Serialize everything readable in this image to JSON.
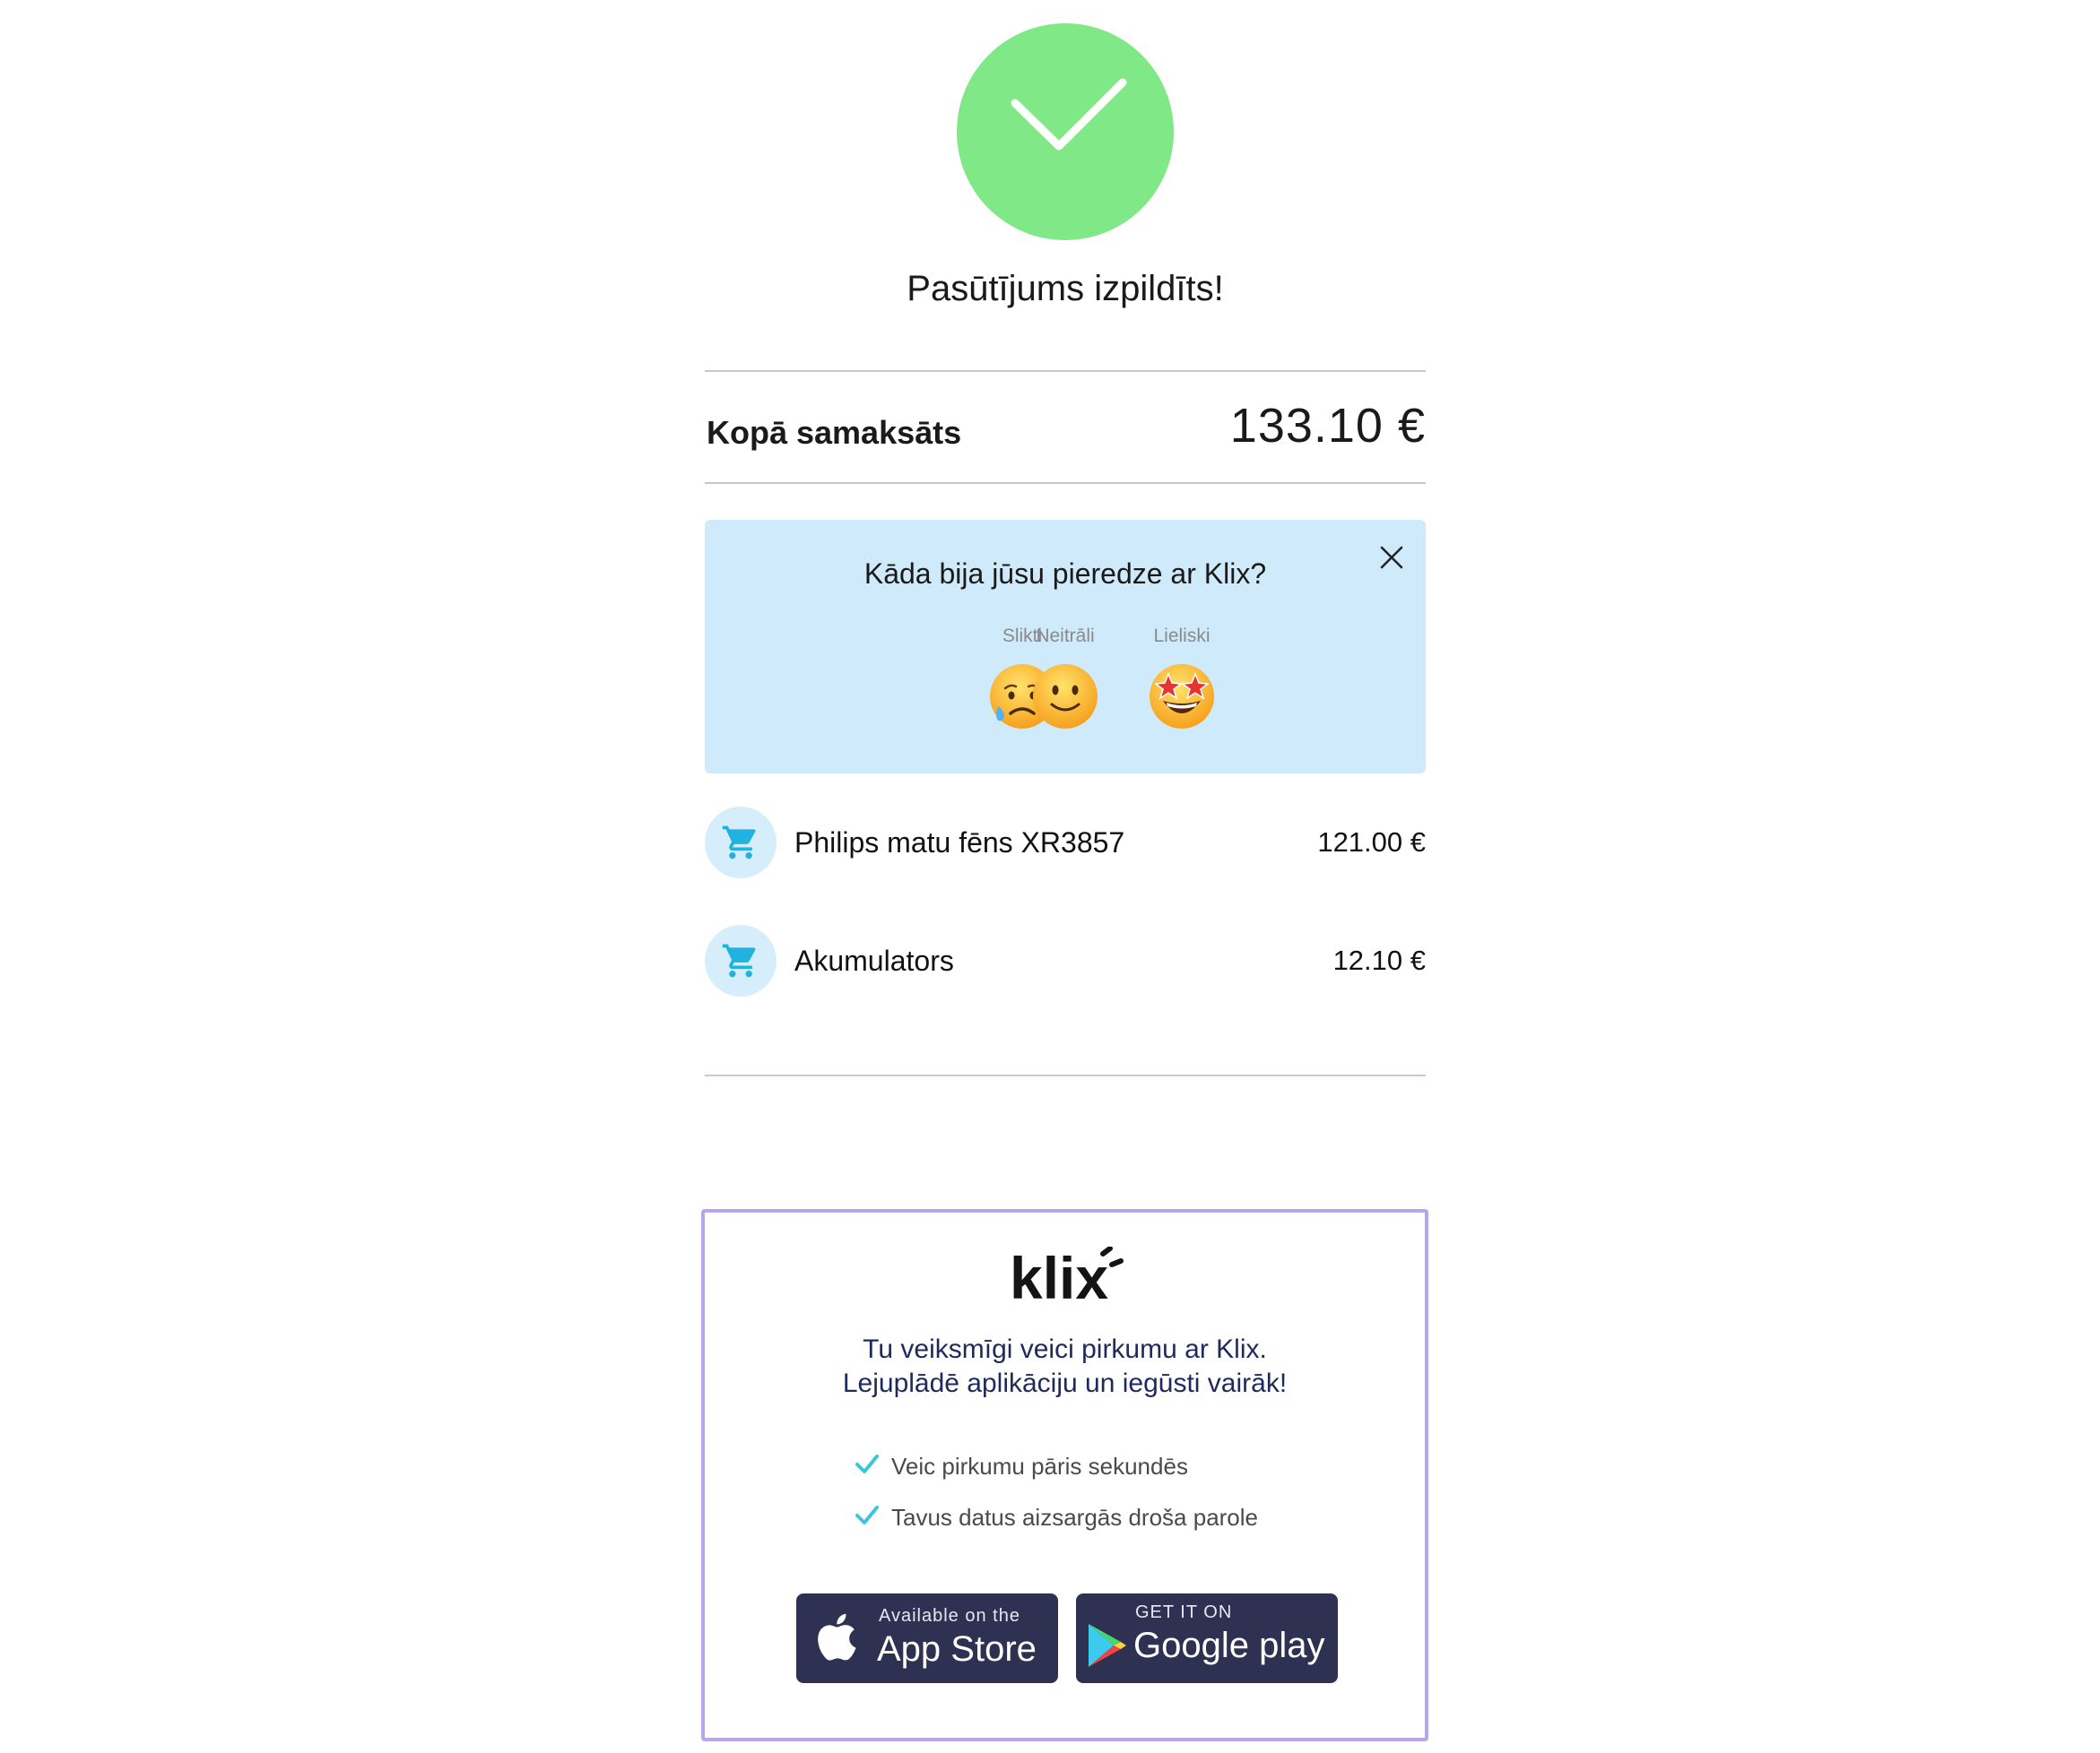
{
  "status": {
    "title": "Pasūtījums izpildīts!",
    "icon": "checkmark-icon",
    "color": "#80e887"
  },
  "summary": {
    "total_label": "Kopā samaksāts",
    "total_value": "133.10 €"
  },
  "feedback": {
    "question": "Kāda bija jūsu pieredze ar Klix?",
    "background": "#cfeafa",
    "options": [
      {
        "label": "Slikti",
        "icon": "sad-face-icon"
      },
      {
        "label": "Neitrāli",
        "icon": "neutral-face-icon"
      },
      {
        "label": "Lieliski",
        "icon": "star-eyes-face-icon"
      }
    ]
  },
  "items": [
    {
      "name": "Philips matu fēns XR3857",
      "price": "121.00 €",
      "icon": "cart-icon"
    },
    {
      "name": "Akumulators",
      "price": "12.10 €",
      "icon": "cart-icon"
    }
  ],
  "promo": {
    "brand": "klix",
    "line1": "Tu veiksmīgi veici pirkumu ar Klix.",
    "line2": "Lejuplādē aplikāciju un iegūsti vairāk!",
    "benefits": [
      "Veic pirkumu pāris sekundēs",
      "Tavus datus aizsargās droša parole"
    ],
    "border_color": "#b9a4ee",
    "app_store": {
      "small": "Available on the",
      "big": "App Store"
    },
    "google_play": {
      "small": "GET IT ON",
      "big": "Google play"
    }
  }
}
